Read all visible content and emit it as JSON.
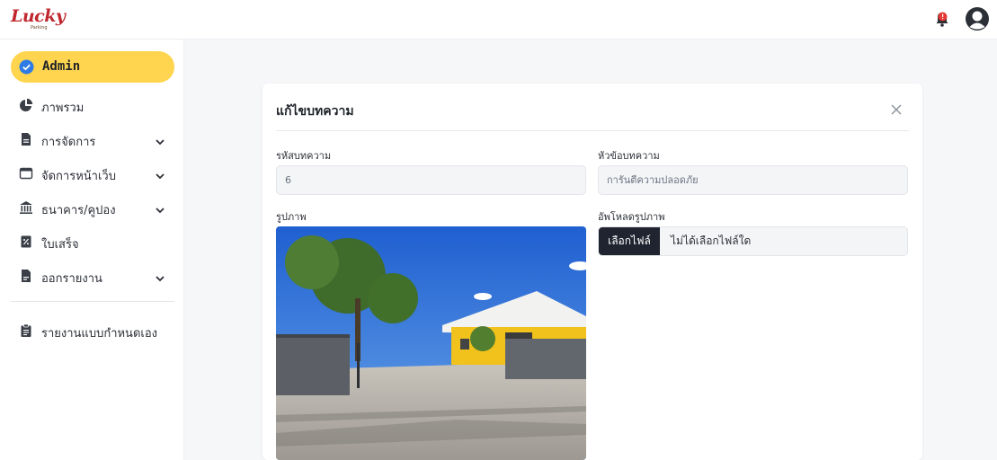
{
  "app": {
    "logo_text": "Lucky",
    "logo_subtext": "Parking"
  },
  "header": {
    "notification_icon": "bell-icon",
    "profile_icon": "user-avatar-icon"
  },
  "sidebar": {
    "active": "Admin",
    "items": [
      {
        "label": "ภาพรวม",
        "icon": "pie-chart-icon",
        "has_children": false
      },
      {
        "label": "การจัดการ",
        "icon": "document-icon",
        "has_children": true
      },
      {
        "label": "จัดการหน้าเว็บ",
        "icon": "browser-window-icon",
        "has_children": true
      },
      {
        "label": "ธนาคาร/คูปอง",
        "icon": "bank-icon",
        "has_children": true
      },
      {
        "label": "ใบเสร็จ",
        "icon": "receipt-icon",
        "has_children": false
      },
      {
        "label": "ออกรายงาน",
        "icon": "report-file-icon",
        "has_children": true
      },
      {
        "label": "รายงานแบบกำหนดเอง",
        "icon": "clipboard-icon",
        "has_children": false
      }
    ]
  },
  "form": {
    "title": "แก้ไขบทความ",
    "article_id_label": "รหัสบทความ",
    "article_id_value": "6",
    "topic_label": "หัวข้อบทความ",
    "topic_value": "การันตีความปลอดภัย",
    "image_label": "รูปภาพ",
    "upload_label": "อัพโหลดรูปภาพ",
    "choose_file_button": "เลือกไฟล์",
    "no_file_text": "ไม่ได้เลือกไฟล์ใด"
  },
  "colors": {
    "accent": "#ffd54f",
    "brand": "#c0262d",
    "file_button": "#1f2430",
    "notification": "#e53935"
  }
}
